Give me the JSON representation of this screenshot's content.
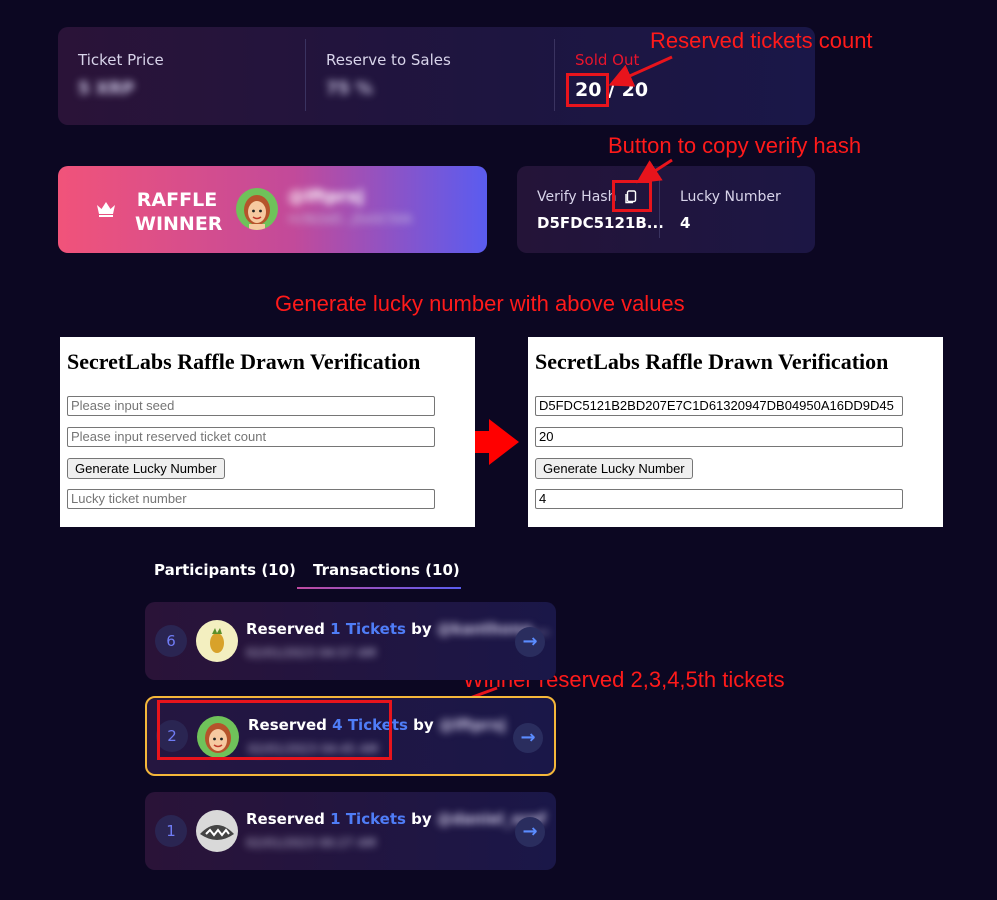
{
  "stats": {
    "ticket_price_label": "Ticket Price",
    "ticket_price_value": "5 XRP",
    "reserve_label": "Reserve to Sales",
    "reserve_value": "75 %",
    "sold_out_label": "Sold Out",
    "reserved_count": "20",
    "separator": "/",
    "total_count": "20"
  },
  "winner": {
    "title_line1": "RAFFLE",
    "title_line2": "WINNER",
    "handle": "@lftprxj",
    "address": "rU3b2eD...J5xGC50A"
  },
  "verify": {
    "hash_label": "Verify Hash",
    "hash_value": "D5FDC5121B...",
    "lucky_label": "Lucky Number",
    "lucky_value": "4"
  },
  "annotations": {
    "reserved_count": "Reserved tickets count",
    "copy_button": "Button to copy verify hash",
    "generate": "Generate lucky number with above values",
    "winner_reserved": "Winner reserved 2,3,4,5th tickets"
  },
  "verification_before": {
    "title": "SecretLabs Raffle Drawn Verification",
    "seed_placeholder": "Please input seed",
    "count_placeholder": "Please input reserved ticket count",
    "button": "Generate Lucky Number",
    "result_placeholder": "Lucky ticket number"
  },
  "verification_after": {
    "title": "SecretLabs Raffle Drawn Verification",
    "seed_value": "D5FDC5121B2BD207E7C1D61320947DB04950A16DD9D45",
    "count_value": "20",
    "button": "Generate Lucky Number",
    "result_value": "4"
  },
  "tabs": [
    {
      "label": "Participants (10)"
    },
    {
      "label": "Transactions (10)"
    }
  ],
  "transactions": [
    {
      "num": "6",
      "prefix": "Reserved",
      "tickets": "1 Tickets",
      "by": "by",
      "user": "@kanthong...",
      "date": "02/01/2023 04:57 AM"
    },
    {
      "num": "2",
      "prefix": "Reserved",
      "tickets": "4 Tickets",
      "by": "by",
      "user": "@lftprxj",
      "date": "02/01/2023 04:45 AM"
    },
    {
      "num": "1",
      "prefix": "Reserved",
      "tickets": "1 Tickets",
      "by": "by",
      "user": "@daniel_oraf",
      "date": "02/01/2023 00:27 AM"
    }
  ],
  "colors": {
    "background": "#0c0722",
    "sold_out": "#e8142c",
    "accent_blue": "#4f7df7",
    "annotation_red": "#ff1a1a",
    "selected_border": "#f5b73a"
  }
}
